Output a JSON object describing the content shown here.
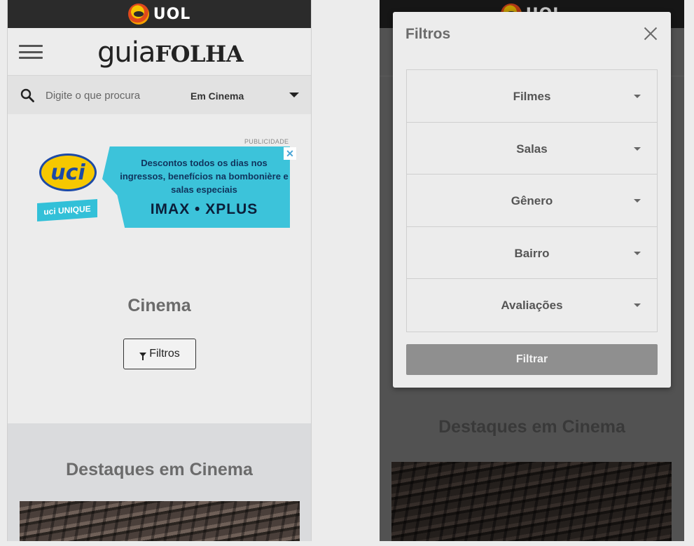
{
  "left": {
    "topbar": {
      "logo_text": "UOL"
    },
    "header": {
      "brand_part1": "guia",
      "brand_part2": "FOLHA"
    },
    "search": {
      "placeholder": "Digite o que procura",
      "category": "Em Cinema"
    },
    "ad": {
      "label": "PUBLICIDADE",
      "logo": "uci",
      "sub_logo": "uci UNIQUE",
      "text": "Descontos todos os dias nos ingressos, benefícios na bombonière e salas especiais",
      "brands": "IMAX • XPLUS",
      "close": "✕"
    },
    "page_title": "Cinema",
    "filter_button": "Filtros",
    "section_title": "Destaques em Cinema"
  },
  "right": {
    "topbar": {
      "logo_text": "UOL"
    },
    "section_title": "Destaques em Cinema",
    "modal": {
      "title": "Filtros",
      "filters": [
        "Filmes",
        "Salas",
        "Gênero",
        "Bairro",
        "Avaliações"
      ],
      "submit": "Filtrar"
    }
  }
}
